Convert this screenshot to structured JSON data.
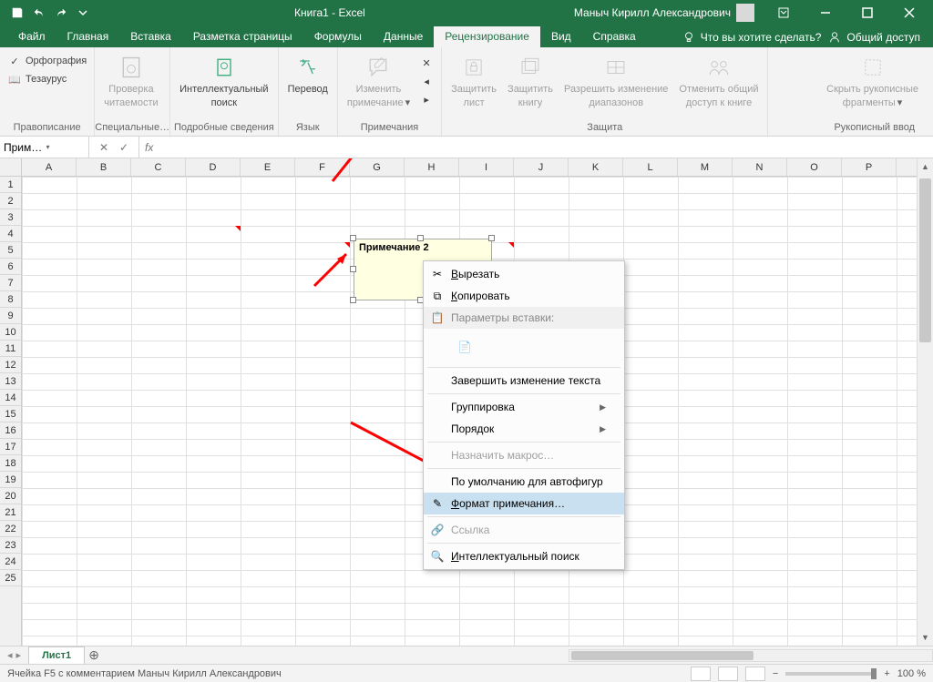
{
  "title": "Книга1  -  Excel",
  "user": "Маныч Кирилл Александрович",
  "qat": {
    "save": "save",
    "undo": "undo",
    "redo": "redo",
    "custom": "customize"
  },
  "tabs": {
    "items": [
      "Файл",
      "Главная",
      "Вставка",
      "Разметка страницы",
      "Формулы",
      "Данные",
      "Рецензирование",
      "Вид",
      "Справка"
    ],
    "active_index": 6,
    "tellme": "Что вы хотите сделать?",
    "share": "Общий доступ"
  },
  "ribbon": {
    "g0": {
      "spell": "Орфография",
      "thesaurus": "Тезаурус",
      "label": "Правописание"
    },
    "g1": {
      "btn1": "Проверка",
      "btn1b": "читаемости",
      "label": "Специальные…"
    },
    "g2": {
      "btn1": "Интеллектуальный",
      "btn1b": "поиск",
      "label": "Подробные сведения"
    },
    "g3": {
      "btn1": "Перевод",
      "label": "Язык"
    },
    "g4": {
      "btn1": "Изменить",
      "btn1b": "примечание",
      "label": "Примечания"
    },
    "g5": {
      "b1": "Защитить",
      "b1b": "лист",
      "b2": "Защитить",
      "b2b": "книгу",
      "b3": "Разрешить изменение",
      "b3b": "диапазонов",
      "b4": "Отменить общий",
      "b4b": "доступ к книге",
      "label": "Защита"
    },
    "g6": {
      "b1": "Скрыть рукописные",
      "b1b": "фрагменты",
      "label": "Рукописный ввод"
    }
  },
  "formula": {
    "name": "Примеча…",
    "fx": "fx",
    "value": ""
  },
  "grid": {
    "cols": [
      "A",
      "B",
      "C",
      "D",
      "E",
      "F",
      "G",
      "H",
      "I",
      "J",
      "K",
      "L",
      "M",
      "N",
      "O",
      "P"
    ],
    "rows_count": 25
  },
  "comment": {
    "text": "Примечание 2"
  },
  "context_menu": {
    "cut": "Вырезать",
    "copy": "Копировать",
    "paste_hdr": "Параметры вставки:",
    "exit": "Завершить изменение текста",
    "group": "Группировка",
    "order": "Порядок",
    "macro": "Назначить макрос…",
    "default": "По умолчанию для автофигур",
    "format": "Формат примечания…",
    "link": "Ссылка",
    "smart": "Интеллектуальный поиск"
  },
  "sheet": {
    "name": "Лист1"
  },
  "status": {
    "text": "Ячейка F5 с комментарием Маныч Кирилл Александрович",
    "zoom": "100 %"
  }
}
